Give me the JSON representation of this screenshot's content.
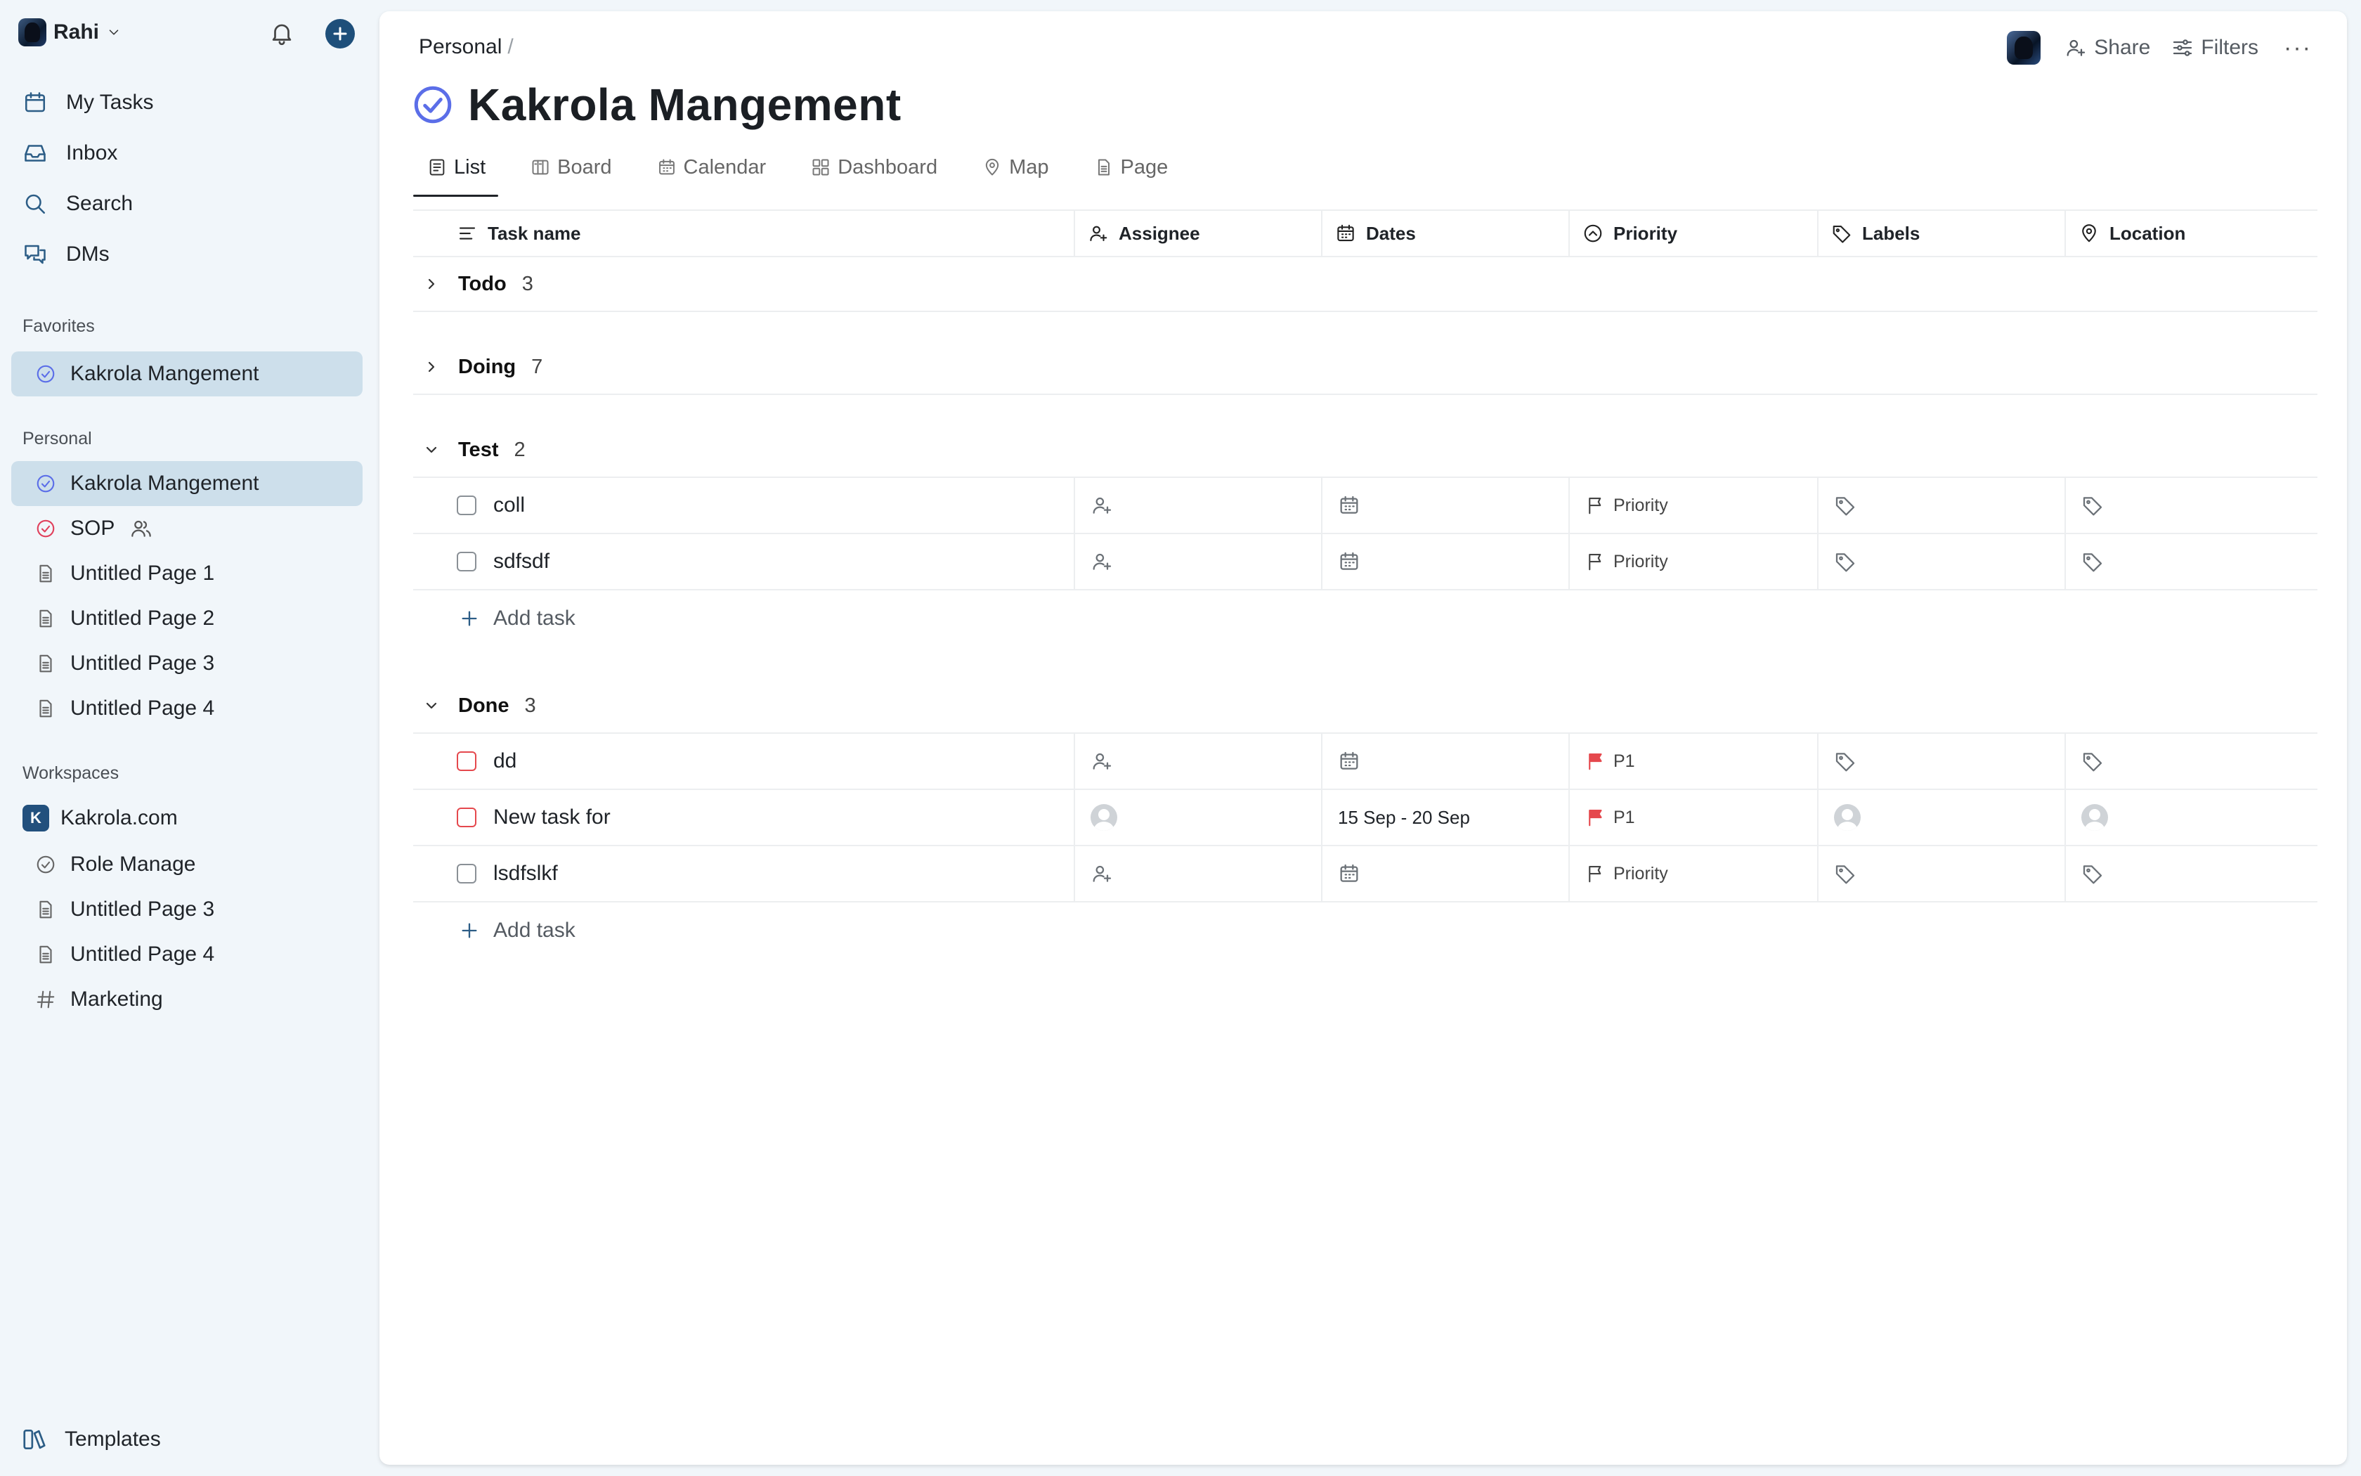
{
  "user": {
    "name": "Rahi"
  },
  "nav": [
    {
      "label": "My Tasks",
      "icon": "calendar-icon"
    },
    {
      "label": "Inbox",
      "icon": "inbox-icon"
    },
    {
      "label": "Search",
      "icon": "search-icon"
    },
    {
      "label": "DMs",
      "icon": "chat-icon"
    }
  ],
  "favorites": {
    "title": "Favorites",
    "items": [
      {
        "label": "Kakrola Mangement"
      }
    ]
  },
  "personal": {
    "title": "Personal",
    "items": [
      {
        "label": "Kakrola Mangement"
      },
      {
        "label": "SOP"
      },
      {
        "label": "Untitled Page 1"
      },
      {
        "label": "Untitled Page 2"
      },
      {
        "label": "Untitled Page 3"
      },
      {
        "label": "Untitled Page 4"
      }
    ]
  },
  "workspaces": {
    "title": "Workspaces",
    "workspace": {
      "badge": "K",
      "label": "Kakrola.com"
    },
    "items": [
      {
        "label": "Role Manage"
      },
      {
        "label": "Untitled Page 3"
      },
      {
        "label": "Untitled Page 4"
      },
      {
        "label": "Marketing"
      }
    ]
  },
  "templates_label": "Templates",
  "main": {
    "breadcrumb": "Personal",
    "breadcrumb_sep": "/",
    "title": "Kakrola Mangement",
    "actions": {
      "share": "Share",
      "filters": "Filters",
      "more": "···"
    },
    "tabs": [
      {
        "label": "List"
      },
      {
        "label": "Board"
      },
      {
        "label": "Calendar"
      },
      {
        "label": "Dashboard"
      },
      {
        "label": "Map"
      },
      {
        "label": "Page"
      }
    ],
    "columns": {
      "task": "Task name",
      "assignee": "Assignee",
      "dates": "Dates",
      "priority": "Priority",
      "labels": "Labels",
      "location": "Location"
    },
    "groups": {
      "todo": {
        "name": "Todo",
        "count": "3"
      },
      "doing": {
        "name": "Doing",
        "count": "7"
      },
      "test": {
        "name": "Test",
        "count": "2",
        "tasks": [
          {
            "name": "coll",
            "priority": "Priority"
          },
          {
            "name": "sdfsdf",
            "priority": "Priority"
          }
        ]
      },
      "done": {
        "name": "Done",
        "count": "3",
        "tasks": [
          {
            "name": "dd",
            "priority": "P1"
          },
          {
            "name": "New task for",
            "dates": "15 Sep - 20 Sep",
            "priority": "P1"
          },
          {
            "name": "lsdfslkf",
            "priority": "Priority"
          }
        ]
      }
    },
    "add_task": "Add task"
  },
  "colors": {
    "accent": "#1e4f7a",
    "active_bg": "#cddfeb",
    "flag_red": "#e5484d",
    "purple": "#5b6ee8"
  }
}
